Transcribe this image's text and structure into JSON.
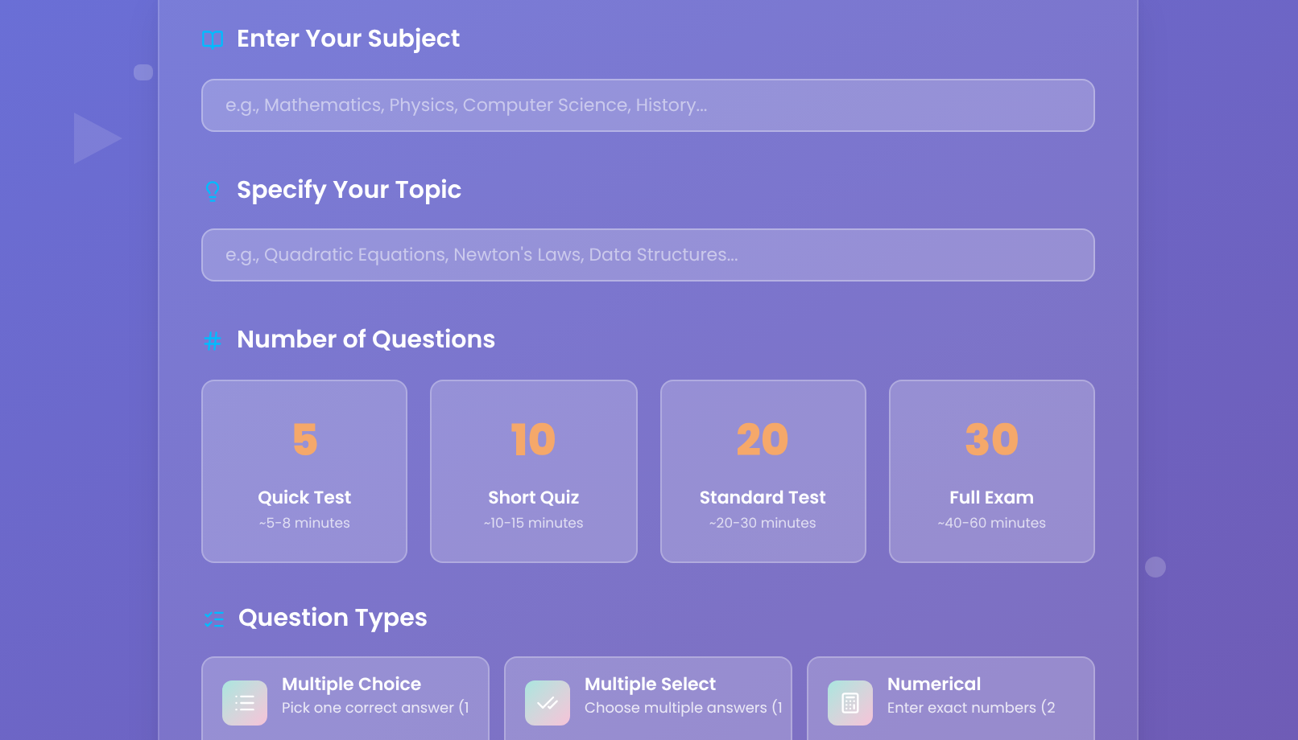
{
  "subject": {
    "label": "Enter Your Subject",
    "placeholder": "e.g., Mathematics, Physics, Computer Science, History..."
  },
  "topic": {
    "label": "Specify Your Topic",
    "placeholder": "e.g., Quadratic Equations, Newton's Laws, Data Structures..."
  },
  "question_count": {
    "label": "Number of Questions",
    "options": [
      {
        "value": "5",
        "name": "Quick Test",
        "duration": "~5-8 minutes"
      },
      {
        "value": "10",
        "name": "Short Quiz",
        "duration": "~10-15 minutes"
      },
      {
        "value": "20",
        "name": "Standard Test",
        "duration": "~20-30 minutes"
      },
      {
        "value": "30",
        "name": "Full Exam",
        "duration": "~40-60 minutes"
      }
    ]
  },
  "question_types": {
    "label": "Question Types",
    "options": [
      {
        "kind": "choice",
        "name": "Multiple Choice",
        "description": "Pick one correct answer (1"
      },
      {
        "kind": "select",
        "name": "Multiple Select",
        "description": "Choose multiple answers (1"
      },
      {
        "kind": "numerical",
        "name": "Numerical",
        "description": "Enter exact numbers (2"
      }
    ]
  }
}
